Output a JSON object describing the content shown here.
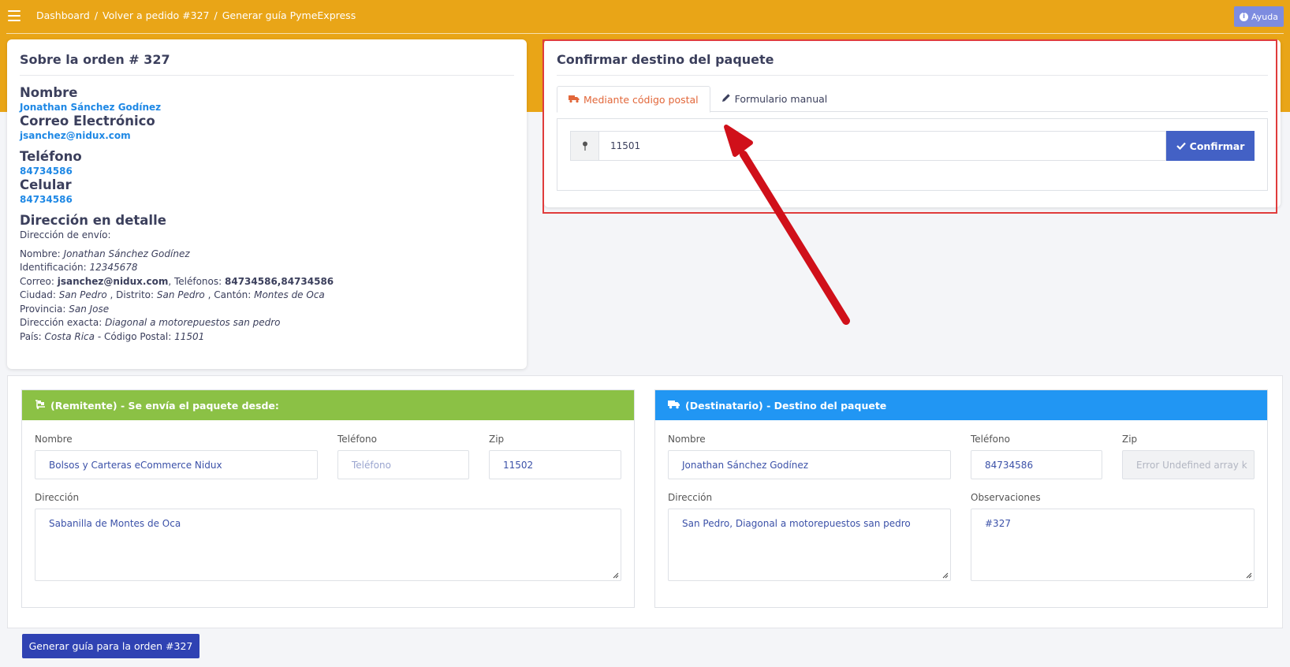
{
  "topbar": {
    "breadcrumb": [
      "Dashboard",
      "Volver a pedido #327",
      "Generar guía PymeExpress"
    ],
    "separator": "/",
    "help_label": "Ayuda"
  },
  "order": {
    "title": "Sobre la orden # 327",
    "name_label": "Nombre",
    "name_value": "Jonathan Sánchez Godínez",
    "email_label": "Correo Electrónico",
    "email_value": "jsanchez@nidux.com",
    "phone_label": "Teléfono",
    "phone_value": "84734586",
    "mobile_label": "Celular",
    "mobile_value": "84734586",
    "address_label": "Dirección en detalle",
    "shipping_label": "Dirección de envío:",
    "details": {
      "nombre_k": "Nombre:",
      "nombre_v": "Jonathan Sánchez Godínez",
      "ident_k": "Identificación:",
      "ident_v": "12345678",
      "correo_k": "Correo:",
      "correo_v": "jsanchez@nidux.com",
      "tel_k": ", Teléfonos:",
      "tel_v": "84734586,84734586",
      "ciudad_k": "Ciudad:",
      "ciudad_v": "San Pedro",
      "distrito_k": ", Distrito:",
      "distrito_v": "San Pedro",
      "canton_k": ", Cantón:",
      "canton_v": "Montes de Oca",
      "provincia_k": "Provincia:",
      "provincia_v": "San Jose",
      "exacta_k": "Dirección exacta:",
      "exacta_v": "Diagonal a motorepuestos san pedro",
      "pais_k": "País:",
      "pais_v": "Costa Rica",
      "postal_k": "- Código Postal:",
      "postal_v": "11501"
    }
  },
  "destination": {
    "title": "Confirmar destino del paquete",
    "tab_postal": "Mediante código postal",
    "tab_manual": "Formulario manual",
    "zip_value": "11501",
    "confirm_label": "Confirmar"
  },
  "sender": {
    "header": "(Remitente) - Se envía el paquete desde:",
    "name_label": "Nombre",
    "name_value": "Bolsos y Carteras eCommerce Nidux",
    "phone_label": "Teléfono",
    "phone_placeholder": "Teléfono",
    "zip_label": "Zip",
    "zip_value": "11502",
    "address_label": "Dirección",
    "address_value": "Sabanilla de Montes de Oca"
  },
  "receiver": {
    "header": "(Destinatario) - Destino del paquete",
    "name_label": "Nombre",
    "name_value": "Jonathan Sánchez Godínez",
    "phone_label": "Teléfono",
    "phone_value": "84734586",
    "zip_label": "Zip",
    "zip_value": "Error Undefined array k",
    "address_label": "Dirección",
    "address_value": "San Pedro, Diagonal a motorepuestos san pedro",
    "notes_label": "Observaciones",
    "notes_value": "#327"
  },
  "generate_label": "Generar guía para la orden #327",
  "colors": {
    "header": "#e9a517",
    "sender": "#8bc145",
    "receiver": "#2196f3",
    "primary": "#4361c5",
    "annotation": "#d0101a"
  },
  "icons": [
    "menu-icon",
    "info-icon",
    "truck-icon",
    "pencil-icon",
    "map-pin-icon",
    "check-icon",
    "dolly-icon"
  ]
}
